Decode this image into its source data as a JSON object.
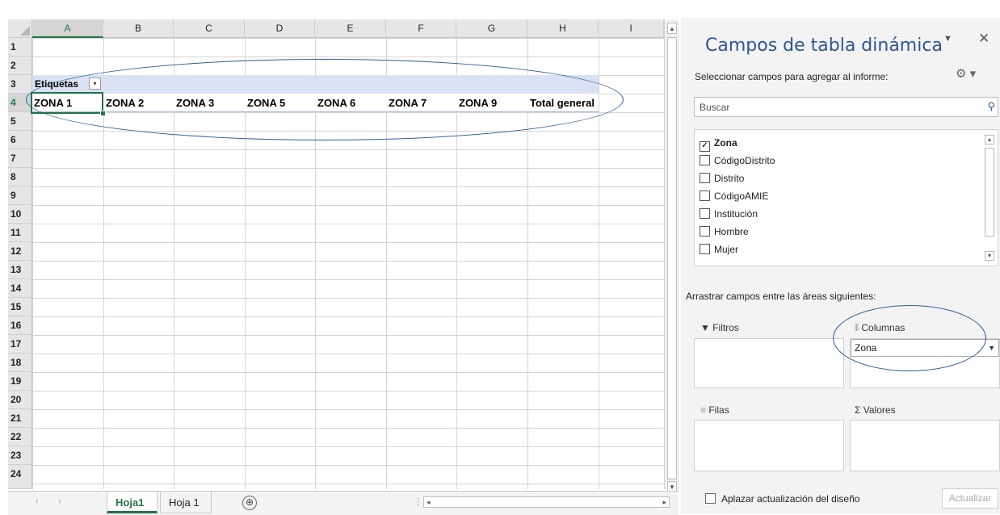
{
  "grid": {
    "columns": [
      "A",
      "B",
      "C",
      "D",
      "E",
      "F",
      "G",
      "H",
      "I"
    ],
    "rows": [
      "1",
      "2",
      "3",
      "4",
      "5",
      "6",
      "7",
      "8",
      "9",
      "10",
      "11",
      "12",
      "13",
      "14",
      "15",
      "16",
      "17",
      "18",
      "19",
      "20",
      "21",
      "22",
      "23",
      "24"
    ],
    "selected_column": "A",
    "selected_row": "4"
  },
  "pivot": {
    "row3_label": "Etiquetas",
    "filter_icon": "▾",
    "headers": [
      "ZONA 1",
      "ZONA 2",
      "ZONA 3",
      "ZONA 5",
      "ZONA 6",
      "ZONA 7",
      "ZONA 9",
      "Total general"
    ]
  },
  "sheet_tabs": {
    "tabs": [
      "Hoja1",
      "Hoja 1"
    ],
    "active": "Hoja1",
    "add_icon": "⊕"
  },
  "panel": {
    "title": "Campos de tabla dinámica",
    "subtitle": "Seleccionar campos para agregar al informe:",
    "search_placeholder": "Buscar",
    "fields": [
      {
        "label": "Zona",
        "checked": true
      },
      {
        "label": "CódigoDistrito",
        "checked": false
      },
      {
        "label": "Distrito",
        "checked": false
      },
      {
        "label": "CódigoAMIE",
        "checked": false
      },
      {
        "label": "Institución",
        "checked": false
      },
      {
        "label": "Hombre",
        "checked": false
      },
      {
        "label": "Mujer",
        "checked": false
      }
    ],
    "drag_label": "Arrastrar campos entre las áreas siguientes:",
    "areas": {
      "filters": "Filtros",
      "columns": "Columnas",
      "rows": "Filas",
      "values": "Valores"
    },
    "columns_item": "Zona",
    "defer_label": "Aplazar actualización del diseño",
    "update_button": "Actualizar"
  },
  "colors": {
    "accent_green": "#217346",
    "pivot_fill": "#d9e1f2",
    "title_blue": "#2f5597",
    "annotation_blue": "#2e5a9c"
  }
}
